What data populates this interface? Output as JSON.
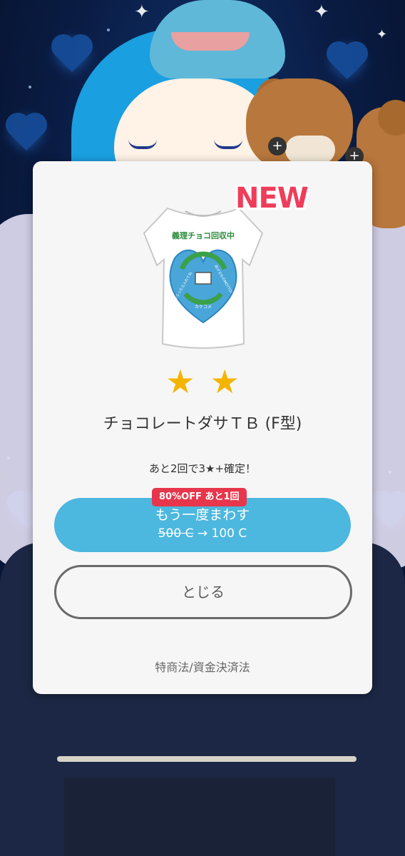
{
  "result": {
    "badge": "NEW",
    "star_glyphs": [
      "★",
      "★"
    ],
    "item_name": "チョコレートダサＴＢ (F型)",
    "guarantee_text": "あと2回で3★+確定！",
    "shirt_print": {
      "banner": "義理チョコ回収中",
      "left_text": "もらったら入れてね",
      "right_text": "あげるものMOTTO!",
      "bottom_text": "カケコメ"
    }
  },
  "spin_again": {
    "discount_badge": "80%OFF あと1回",
    "label": "もう一度まわす",
    "old_price": "500 C",
    "arrow": " → ",
    "new_price": "100 C"
  },
  "close_button": {
    "label": "とじる"
  },
  "legal_link": {
    "label": "特商法/資金決済法"
  },
  "colors": {
    "spin_button": "#4cb7df",
    "new_badge": "#ef3d5a",
    "discount_badge": "#e7364c",
    "star": "#f5b400"
  }
}
